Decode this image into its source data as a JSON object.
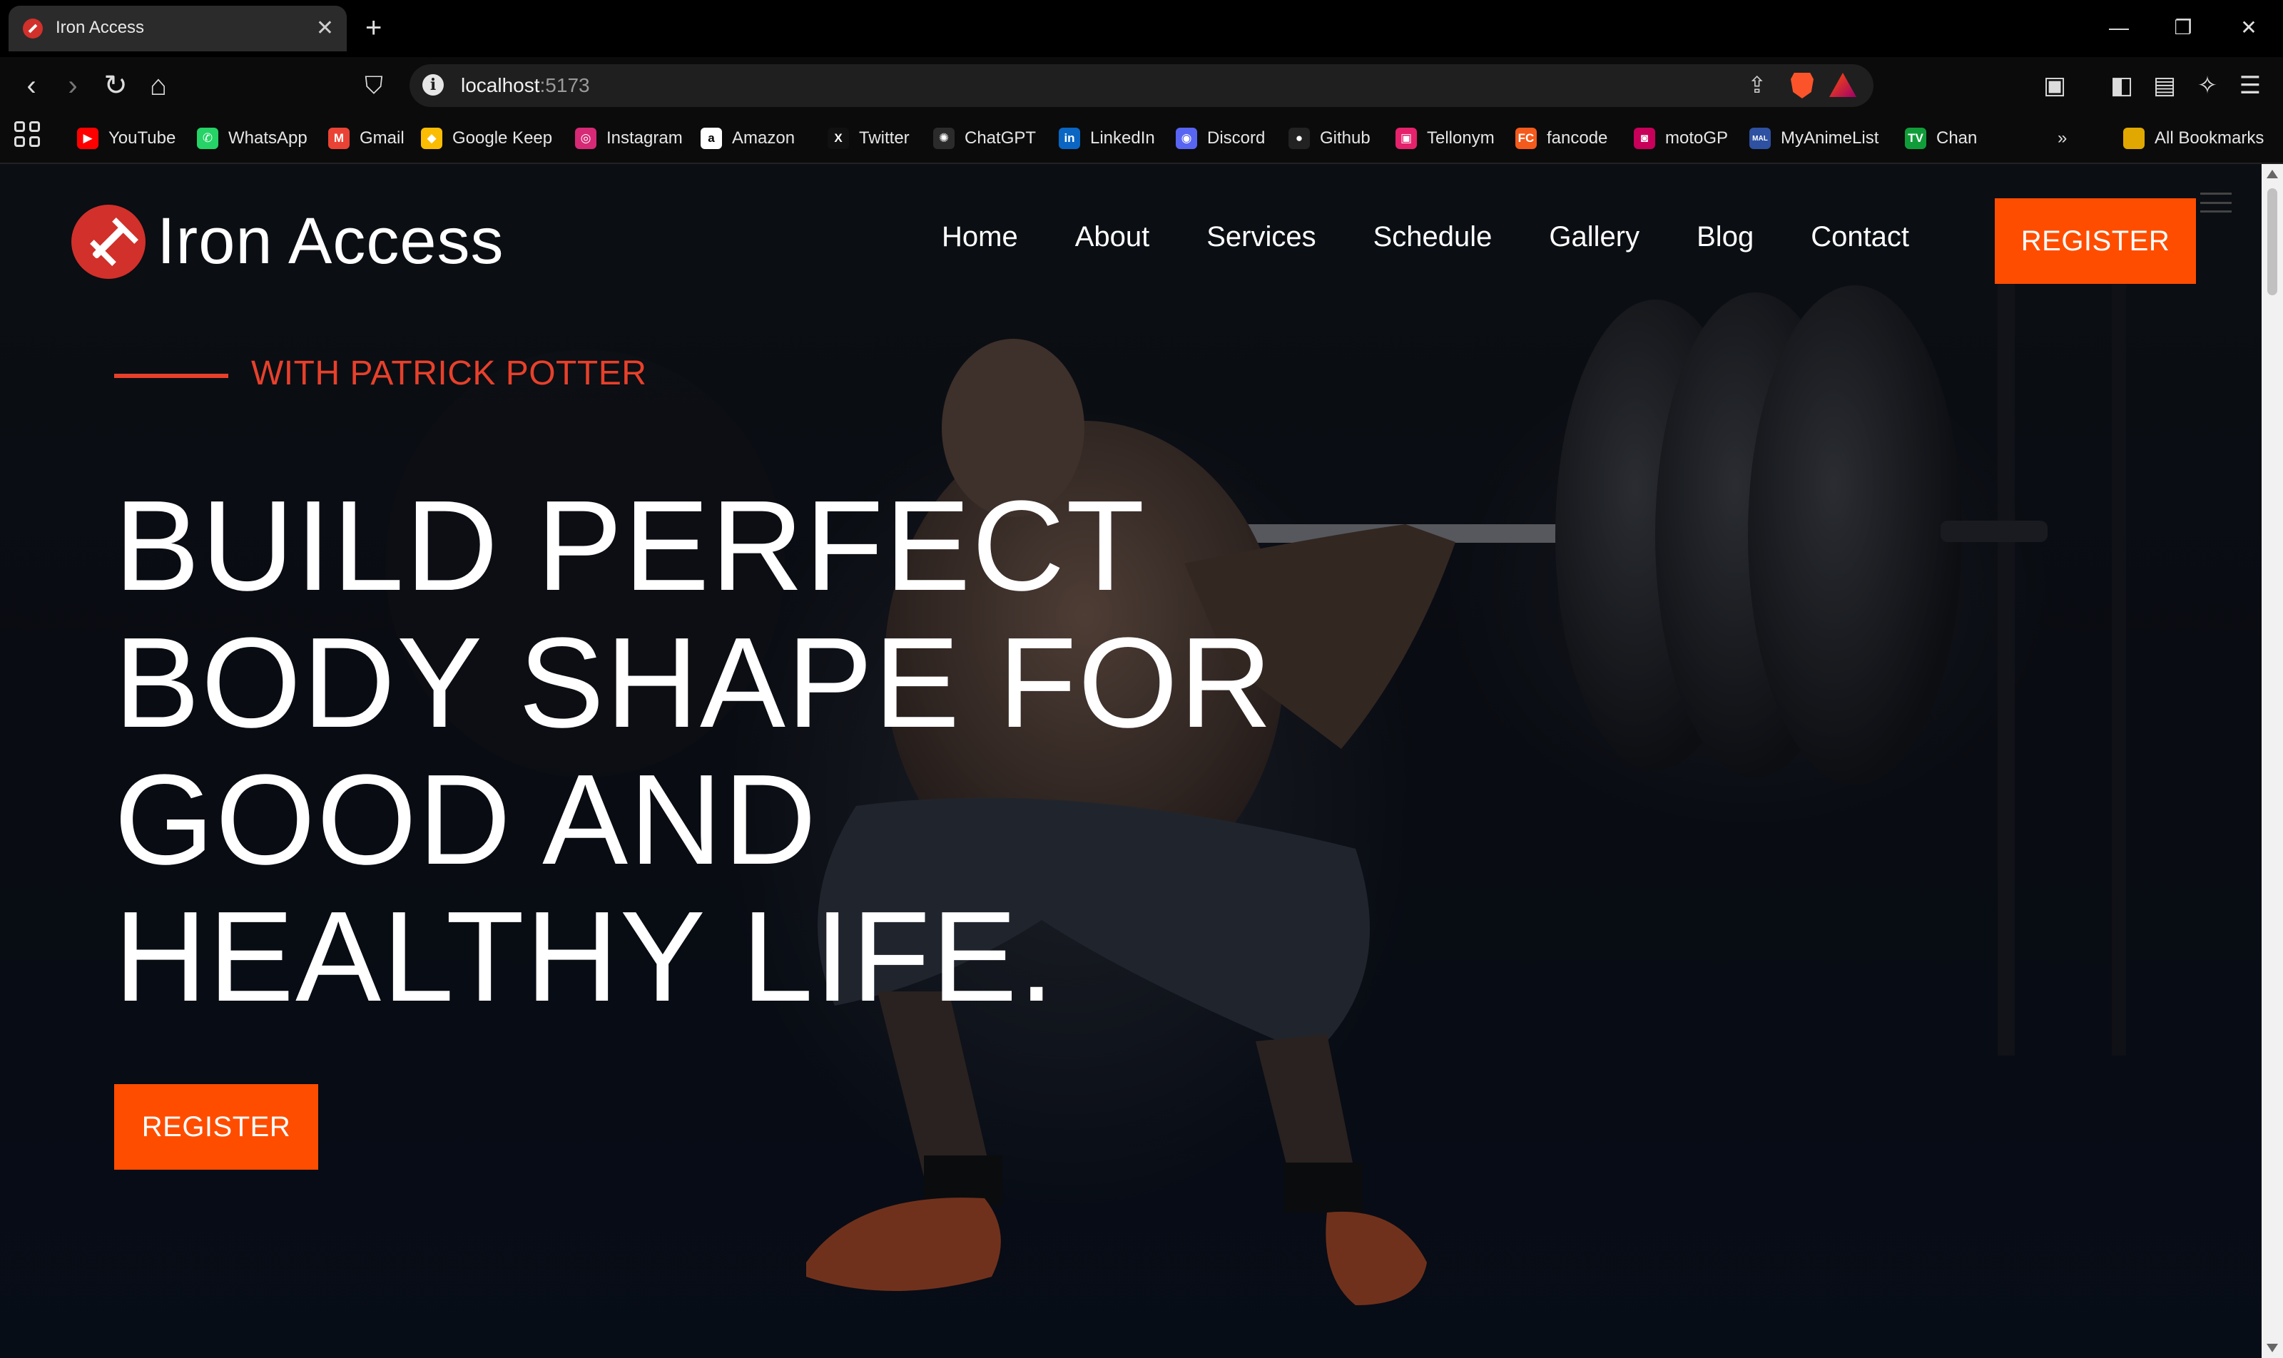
{
  "browser": {
    "tab_title": "Iron Access",
    "tab_close": "✕",
    "new_tab": "+",
    "url_host": "localhost",
    "url_port": ":5173",
    "bookmarks": [
      {
        "label": "YouTube",
        "color": "#ff0000",
        "glyph": "▶"
      },
      {
        "label": "WhatsApp",
        "color": "#25d366",
        "glyph": "✆"
      },
      {
        "label": "Gmail",
        "color": "#ea4335",
        "glyph": "M"
      },
      {
        "label": "Google Keep",
        "color": "#fbbc04",
        "glyph": "◆"
      },
      {
        "label": "Instagram",
        "color": "#d62976",
        "glyph": "◎"
      },
      {
        "label": "Amazon",
        "color": "#ffffff",
        "glyph": "a"
      },
      {
        "label": "Twitter",
        "color": "#111111",
        "glyph": "X"
      },
      {
        "label": "ChatGPT",
        "color": "#2b2b2b",
        "glyph": "✺"
      },
      {
        "label": "LinkedIn",
        "color": "#0a66c2",
        "glyph": "in"
      },
      {
        "label": "Discord",
        "color": "#5865f2",
        "glyph": "◉"
      },
      {
        "label": "Github",
        "color": "#222222",
        "glyph": "●"
      },
      {
        "label": "Tellonym",
        "color": "#e5226b",
        "glyph": "▣"
      },
      {
        "label": "fancode",
        "color": "#f35a1c",
        "glyph": "FC"
      },
      {
        "label": "motoGP",
        "color": "#c8005a",
        "glyph": "◙"
      },
      {
        "label": "MyAnimeList",
        "color": "#2e51a2",
        "glyph": "MAL"
      },
      {
        "label": "Chan",
        "color": "#119c3a",
        "glyph": "TV"
      }
    ],
    "all_bookmarks": "All Bookmarks",
    "overflow": "»"
  },
  "site": {
    "brand": "Iron Access",
    "nav": [
      "Home",
      "About",
      "Services",
      "Schedule",
      "Gallery",
      "Blog",
      "Contact"
    ],
    "register_top": "REGISTER",
    "eyebrow": "WITH PATRICK POTTER",
    "headline": [
      "BUILD PERFECT",
      "BODY SHAPE FOR",
      "GOOD AND",
      "HEALTHY LIFE."
    ],
    "register_hero": "REGISTER",
    "accent": "#ff4d00",
    "eyebrow_color": "#e8402b",
    "logo_color": "#d2302b"
  }
}
